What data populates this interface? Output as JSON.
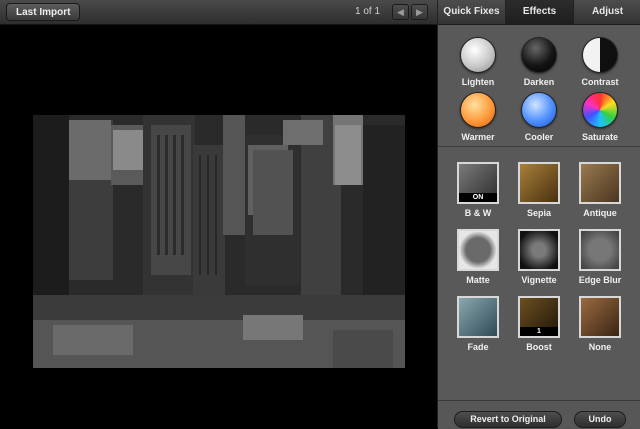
{
  "toolbar": {
    "last_import_label": "Last Import",
    "counter": "1 of 1",
    "prev_icon": "arrow-left-icon",
    "next_icon": "arrow-right-icon"
  },
  "tabs": [
    {
      "label": "Quick Fixes",
      "active": false
    },
    {
      "label": "Effects",
      "active": true
    },
    {
      "label": "Adjust",
      "active": false
    }
  ],
  "orbs": [
    {
      "label": "Lighten",
      "color": "#e6e6e6"
    },
    {
      "label": "Darken",
      "color": "#111111"
    },
    {
      "label": "Contrast",
      "color": "#888888"
    },
    {
      "label": "Warmer",
      "color": "#ff9a3a"
    },
    {
      "label": "Cooler",
      "color": "#4e8fff"
    },
    {
      "label": "Saturate",
      "color": "#ff40a0"
    }
  ],
  "effects": [
    {
      "label": "B & W",
      "badge": "ON",
      "tone": "#5a5a5a"
    },
    {
      "label": "Sepia",
      "badge": "",
      "tone": "#7a5a2a"
    },
    {
      "label": "Antique",
      "badge": "",
      "tone": "#6f5a3a"
    },
    {
      "label": "Matte",
      "badge": "",
      "tone": "#6a6a6a"
    },
    {
      "label": "Vignette",
      "badge": "",
      "tone": "#3f3f3f"
    },
    {
      "label": "Edge Blur",
      "badge": "",
      "tone": "#666666"
    },
    {
      "label": "Fade",
      "badge": "",
      "tone": "#4c6a75"
    },
    {
      "label": "Boost",
      "badge": "1",
      "tone": "#4a3a1a"
    },
    {
      "label": "None",
      "badge": "",
      "tone": "#6a4a30"
    }
  ],
  "actions": {
    "revert_label": "Revert to Original",
    "undo_label": "Undo"
  }
}
